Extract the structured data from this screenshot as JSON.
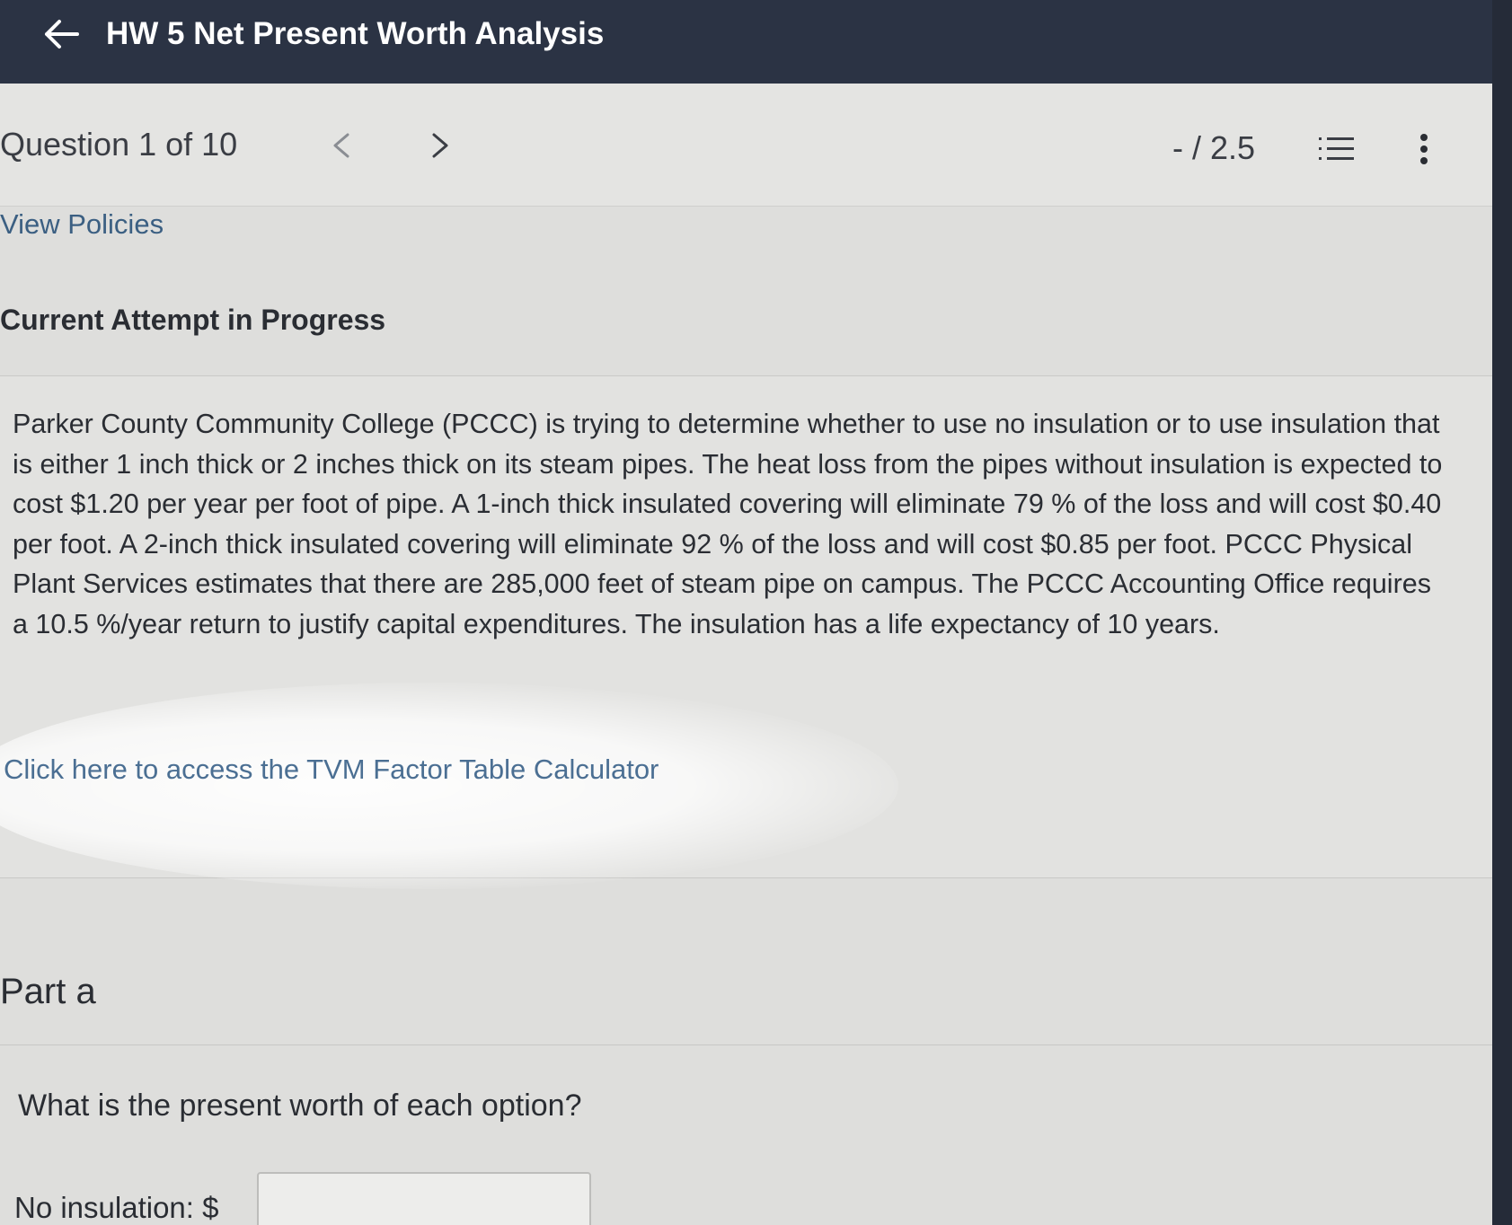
{
  "header": {
    "title": "HW 5 Net Present Worth Analysis"
  },
  "question_nav": {
    "counter": "Question 1 of 10",
    "score": "- / 2.5"
  },
  "links": {
    "view_policies": "View Policies",
    "tvm_calculator": "Click here to access the TVM Factor Table Calculator"
  },
  "attempt_status": "Current Attempt in Progress",
  "question": {
    "text": "Parker County Community College (PCCC) is trying to determine whether to use no insulation or to use insulation that is either 1 inch thick or 2 inches thick on its steam pipes. The heat loss from the pipes without insulation is expected to cost $1.20 per year per foot of pipe. A 1-inch thick insulated covering will eliminate 79 % of the loss and will cost $0.40 per foot. A 2-inch thick insulated covering will eliminate 92 % of the loss and will cost $0.85 per foot. PCCC Physical Plant Services estimates that there are 285,000 feet of steam pipe on campus. The PCCC Accounting Office requires a 10.5 %/year return to justify capital expenditures. The insulation has a life expectancy of 10 years."
  },
  "part_a": {
    "heading": "Part a",
    "prompt": "What is the present worth of each option?",
    "answers": [
      {
        "label": "No insulation: $",
        "value": ""
      }
    ]
  },
  "icons": {
    "back": "arrow-left-icon",
    "prev": "chevron-left-icon",
    "next": "chevron-right-icon",
    "list": "numbered-list-icon",
    "more": "more-vertical-icon"
  },
  "colors": {
    "header_bg": "#2b3344",
    "link": "#3b5f82",
    "text": "#2a2d33"
  }
}
